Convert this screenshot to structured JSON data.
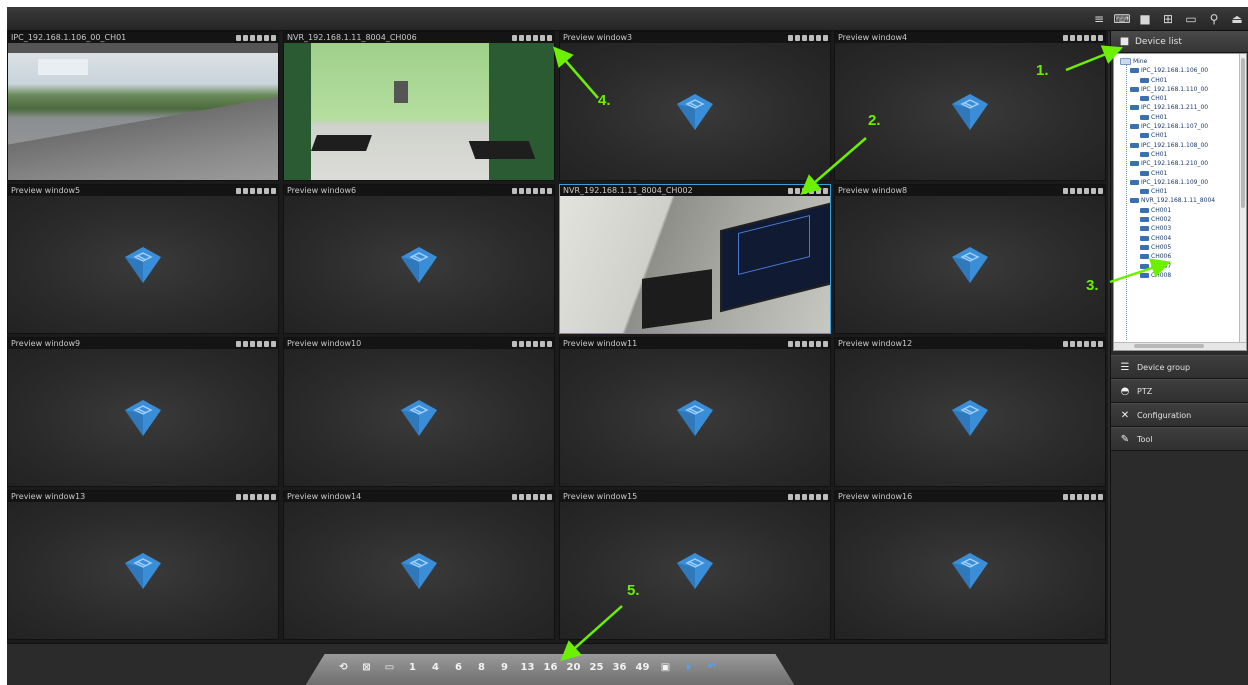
{
  "toolbar": {
    "icons": [
      "menu-icon",
      "monitor-icon",
      "camera-icon",
      "grid-icon",
      "window-icon",
      "pin-icon",
      "lock-icon"
    ]
  },
  "cells": [
    {
      "title": "IPC_192.168.1.106_00_CH01",
      "feed": "outdoor"
    },
    {
      "title": "NVR_192.168.1.11_8004_CH006",
      "feed": "lobby"
    },
    {
      "title": "Preview window3",
      "feed": "empty"
    },
    {
      "title": "Preview window4",
      "feed": "empty"
    },
    {
      "title": "Preview window5",
      "feed": "empty"
    },
    {
      "title": "Preview window6",
      "feed": "empty"
    },
    {
      "title": "NVR_192.168.1.11_8004_CH002",
      "feed": "room",
      "selected": true
    },
    {
      "title": "Preview window8",
      "feed": "empty"
    },
    {
      "title": "Preview window9",
      "feed": "empty"
    },
    {
      "title": "Preview window10",
      "feed": "empty"
    },
    {
      "title": "Preview window11",
      "feed": "empty"
    },
    {
      "title": "Preview window12",
      "feed": "empty"
    },
    {
      "title": "Preview window13",
      "feed": "empty"
    },
    {
      "title": "Preview window14",
      "feed": "empty"
    },
    {
      "title": "Preview window15",
      "feed": "empty"
    },
    {
      "title": "Preview window16",
      "feed": "empty"
    }
  ],
  "panel": {
    "header": "Device list",
    "tree": [
      {
        "label": "Mine",
        "level": 0
      },
      {
        "label": "IPC_192.168.1.106_00",
        "level": 1
      },
      {
        "label": "CH01",
        "level": 2
      },
      {
        "label": "IPC_192.168.1.110_00",
        "level": 1
      },
      {
        "label": "CH01",
        "level": 2
      },
      {
        "label": "IPC_192.168.1.211_00",
        "level": 1
      },
      {
        "label": "CH01",
        "level": 2
      },
      {
        "label": "IPC_192.168.1.107_00",
        "level": 1
      },
      {
        "label": "CH01",
        "level": 2
      },
      {
        "label": "IPC_192.168.1.108_00",
        "level": 1
      },
      {
        "label": "CH01",
        "level": 2
      },
      {
        "label": "IPC_192.168.1.210_00",
        "level": 1
      },
      {
        "label": "CH01",
        "level": 2
      },
      {
        "label": "IPC_192.168.1.109_00",
        "level": 1
      },
      {
        "label": "CH01",
        "level": 2
      },
      {
        "label": "NVR_192.168.1.11_8004",
        "level": 1
      },
      {
        "label": "CH001",
        "level": 2
      },
      {
        "label": "CH002",
        "level": 2
      },
      {
        "label": "CH003",
        "level": 2
      },
      {
        "label": "CH004",
        "level": 2
      },
      {
        "label": "CH005",
        "level": 2
      },
      {
        "label": "CH006",
        "level": 2
      },
      {
        "label": "CH007",
        "level": 2
      },
      {
        "label": "CH008",
        "level": 2
      }
    ],
    "buttons": [
      {
        "label": "Device group",
        "icon": "list-icon"
      },
      {
        "label": "PTZ",
        "icon": "ptz-icon"
      },
      {
        "label": "Configuration",
        "icon": "tools-icon"
      },
      {
        "label": "Tool",
        "icon": "wrench-icon"
      }
    ]
  },
  "layout_buttons": [
    "⟲",
    "⊠",
    "▭",
    "1",
    "4",
    "6",
    "8",
    "9",
    "13",
    "16",
    "20",
    "25",
    "36",
    "49",
    "▣",
    "⏸",
    "↶"
  ],
  "annotations": [
    "1.",
    "2.",
    "3.",
    "4.",
    "5."
  ],
  "colors": {
    "accent": "#3aa0d8",
    "annotation": "#6bf000",
    "logo": "#3a8ed8"
  }
}
